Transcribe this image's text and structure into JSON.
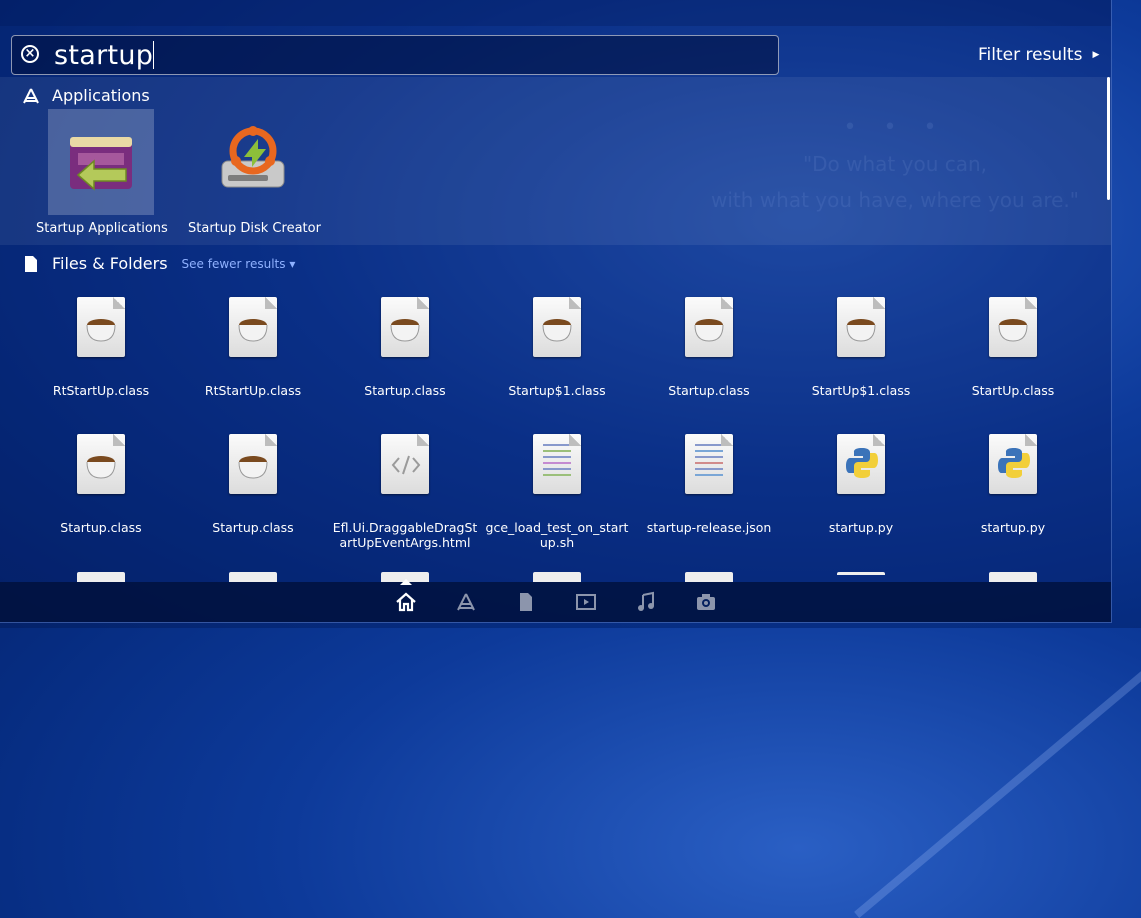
{
  "search": {
    "query": "startup"
  },
  "filter": {
    "label": "Filter results"
  },
  "background": {
    "dots": "• • •",
    "quote_line1": "\"Do what you can,",
    "quote_line2": "with what you have, where you are.\""
  },
  "categories": {
    "applications": {
      "title": "Applications"
    },
    "files": {
      "title": "Files & Folders",
      "see_fewer": "See fewer results"
    }
  },
  "applications": [
    {
      "label": "Startup Applications",
      "icon": "startup-applications-icon",
      "selected": true
    },
    {
      "label": "Startup Disk Creator",
      "icon": "startup-disk-creator-icon",
      "selected": false
    }
  ],
  "files_row1": [
    {
      "label": "RtStartUp.class",
      "icon": "java-class-icon"
    },
    {
      "label": "RtStartUp.class",
      "icon": "java-class-icon"
    },
    {
      "label": "Startup.class",
      "icon": "java-class-icon"
    },
    {
      "label": "Startup$1.class",
      "icon": "java-class-icon"
    },
    {
      "label": "Startup.class",
      "icon": "java-class-icon"
    },
    {
      "label": "StartUp$1.class",
      "icon": "java-class-icon"
    },
    {
      "label": "StartUp.class",
      "icon": "java-class-icon"
    }
  ],
  "files_row2": [
    {
      "label": "Startup.class",
      "icon": "java-class-icon"
    },
    {
      "label": "Startup.class",
      "icon": "java-class-icon"
    },
    {
      "label": "Efl.Ui.DraggableDragStartUpEventArgs.html",
      "icon": "html-file-icon"
    },
    {
      "label": "gce_load_test_on_startup.sh",
      "icon": "shell-script-icon"
    },
    {
      "label": "startup-release.json",
      "icon": "json-file-icon"
    },
    {
      "label": "startup.py",
      "icon": "python-file-icon"
    },
    {
      "label": "startup.py",
      "icon": "python-file-icon"
    }
  ],
  "lenses": [
    {
      "name": "home-lens-icon",
      "active": true
    },
    {
      "name": "applications-lens-icon",
      "active": false
    },
    {
      "name": "files-lens-icon",
      "active": false
    },
    {
      "name": "video-lens-icon",
      "active": false
    },
    {
      "name": "music-lens-icon",
      "active": false
    },
    {
      "name": "photo-lens-icon",
      "active": false
    }
  ],
  "colors": {
    "accent_link": "#8fb1ff",
    "background": "#0d3a9a"
  }
}
